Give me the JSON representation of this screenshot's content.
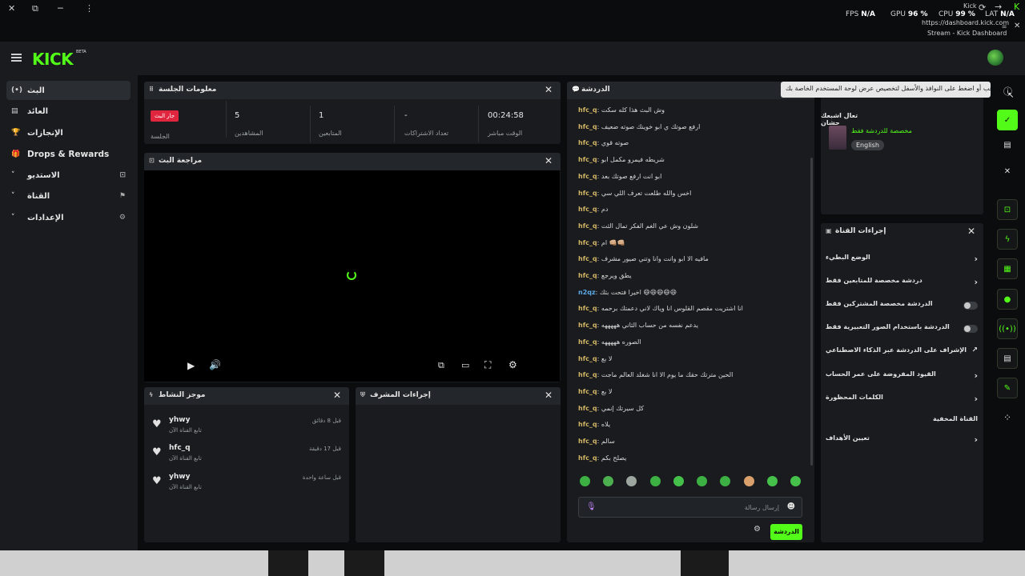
{
  "system": {
    "close": "✕",
    "restore": "⧉",
    "minimize": "─",
    "more": "⋮",
    "fps_label": "FPS",
    "fps_value": "N/A",
    "gpu_label": "GPU",
    "gpu_value": "96 %",
    "cpu_label": "CPU",
    "cpu_value": "99 %",
    "lat_label": "LAT",
    "lat_value": "N/A",
    "site_name": "Kick",
    "url": "https://dashboard.kick.com",
    "page_title": "Stream - Kick Dashboard"
  },
  "header": {
    "logo": "KICK",
    "beta": "BETA"
  },
  "sidebar": {
    "items": [
      {
        "label": "البث",
        "icon": "(•)"
      },
      {
        "label": "العائد",
        "icon": "▤"
      },
      {
        "label": "الإنجازات",
        "icon": "🏆"
      },
      {
        "label": "Drops & Rewards",
        "icon": "🎁"
      },
      {
        "label": "الاستديو",
        "icon": "˅",
        "right": "⊡"
      },
      {
        "label": "القناة",
        "icon": "˅",
        "right": "⚑"
      },
      {
        "label": "الإعدادات",
        "icon": "˅",
        "right": "⚙"
      }
    ]
  },
  "session": {
    "title": "معلومات الجلسة",
    "badge": "جار البث",
    "badge_label": "الجلسة",
    "stats": [
      {
        "value": "5",
        "label": "المشاهدين"
      },
      {
        "value": "1",
        "label": "المتابعين"
      },
      {
        "value": "-",
        "label": "تعداد الاشتراكات"
      },
      {
        "value": "00:24:58",
        "label": "الوقت مباشر"
      }
    ]
  },
  "preview": {
    "title": "مراجعة البث"
  },
  "activity": {
    "title": "موجز النشاط",
    "items": [
      {
        "name": "yhwy",
        "sub": "تابع القناة الآن",
        "time": "قبل 8 دقائق"
      },
      {
        "name": "hfc_q",
        "sub": "تابع القناة الآن",
        "time": "قبل 17 دقيقة"
      },
      {
        "name": "yhwy",
        "sub": "تابع القناة الآن",
        "time": "قبل ساعة واحدة"
      }
    ]
  },
  "modactions": {
    "title": "إجراءات المشرف"
  },
  "chat": {
    "title": "الدردشة",
    "messages": [
      {
        "user": "hfc_q",
        "text": "وش البث هذا كله سكت"
      },
      {
        "user": "hfc_q",
        "text": "ارفع صوتك ي ابو خوينك صوته ضعيف"
      },
      {
        "user": "hfc_q",
        "text": "صوته قوي"
      },
      {
        "user": "hfc_q",
        "text": "شريطه فيمرو مكمل ابو"
      },
      {
        "user": "hfc_q",
        "text": "ابو انت ارفع صوتك بعد"
      },
      {
        "user": "hfc_q",
        "text": "اخس والله طلعت تعرف اللي سي"
      },
      {
        "user": "hfc_q",
        "text": "دم"
      },
      {
        "user": "hfc_q",
        "text": "شلون وش عي الغم الفكر تمال الثت"
      },
      {
        "user": "hfc_q",
        "text": "ام 👊🏼👊🏼"
      },
      {
        "user": "hfc_q",
        "text": "مافيه الا ابو وانت وانا وتني صيور مشرف"
      },
      {
        "user": "hfc_q",
        "text": "يطق ويرجع"
      },
      {
        "user": "n2qz",
        "text": "اخيرا فتحت بثك 😄😄😄😄😄"
      },
      {
        "user": "hfc_q",
        "text": "انا اشتريت مقصم القلوس انا وياك لاني دعمتك برحمه"
      },
      {
        "user": "hfc_q",
        "text": "يدعم نفسه من حساب الثاني هههههه"
      },
      {
        "user": "hfc_q",
        "text": "الصوره هههههه"
      },
      {
        "user": "hfc_q",
        "text": "لا بع"
      },
      {
        "user": "hfc_q",
        "text": "الحين مترتك حقك ما يوم الا انا شغلد العالم ماجت"
      },
      {
        "user": "hfc_q",
        "text": "لا بع"
      },
      {
        "user": "hfc_q",
        "text": "كل سيرتك إنمي"
      },
      {
        "user": "hfc_q",
        "text": "يلاه"
      },
      {
        "user": "hfc_q",
        "text": "سالم"
      },
      {
        "user": "hfc_q",
        "text": "يصلح بكم"
      }
    ],
    "placeholder": "إرسال رسالة",
    "send": "الدردشة"
  },
  "channel": {
    "title": "تعال اشبعك حشان",
    "mode": "مخصصة للدردشة فقط",
    "lang": "English"
  },
  "channel_actions": {
    "title": "إجراءات القناة",
    "rows": [
      {
        "label": "الوضع البطيء",
        "kind": "chevron"
      },
      {
        "label": "دردشة مخصصة للمتابعين فقط",
        "kind": "chevron"
      },
      {
        "label": "الدردشة مخصصة المشتركين فقط",
        "kind": "toggle"
      },
      {
        "label": "الدردشة باستخدام الصور التعبيرية فقط",
        "kind": "toggle"
      },
      {
        "label": "الإشراف على الدردشة عبر الذكاء الاصطناعي",
        "kind": "ext"
      },
      {
        "label": "القيود المفروضة على عمر الحساب",
        "kind": "chevron"
      },
      {
        "label": "الكلمات المحظورة",
        "kind": "chevron"
      },
      {
        "label": "القناة المخفية",
        "kind": "none"
      },
      {
        "label": "تعيين الأهداف",
        "kind": "chevron"
      }
    ]
  },
  "tooltip": "اسحب أو اضغط على النوافذ والأسفل لتخصيص عرض لوحة المستخدم الخاصة بك",
  "colors": {
    "accent": "#53fc18",
    "live": "#e0263f",
    "panel": "#191b1e"
  }
}
